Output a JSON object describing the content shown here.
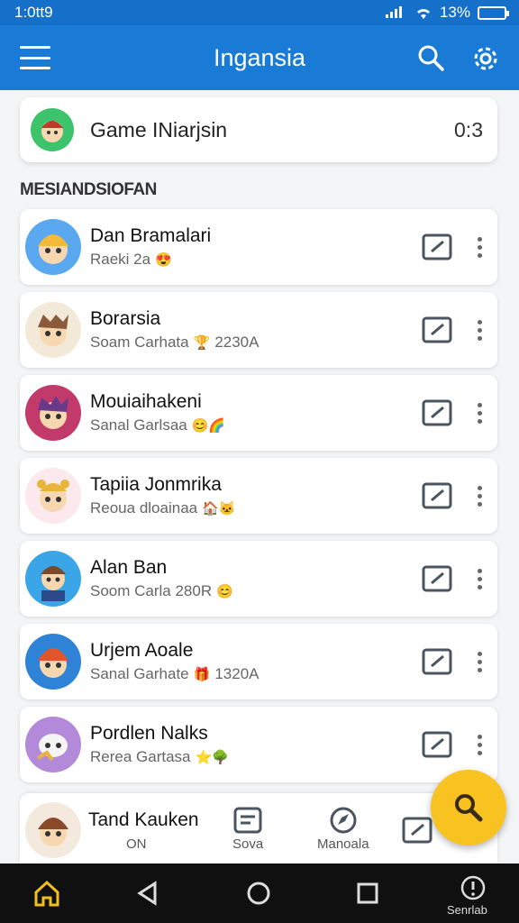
{
  "status_bar": {
    "time": "1:0tt9",
    "battery": "13%"
  },
  "app_bar": {
    "title": "Ingansia",
    "icons": [
      "menu-icon",
      "search-icon",
      "gear-icon"
    ]
  },
  "game_card": {
    "title": "Game INiarjsin",
    "score": "0:3"
  },
  "section_title": "MESIANDSIOFAN",
  "contacts": [
    {
      "name": "Dan Bramalari",
      "status": "Raeki 2a",
      "emoji": "😍",
      "extra": "",
      "avatar_bg": "#5aa8ef"
    },
    {
      "name": "Borarsia",
      "status": "Soam Carhata",
      "emoji": "🏆",
      "extra": "2230A",
      "avatar_bg": "#f2e9d8"
    },
    {
      "name": "Mouiaihakeni",
      "status": "Sanal Garlsaa",
      "emoji": "😊🌈",
      "extra": "",
      "avatar_bg": "#c23a6a"
    },
    {
      "name": "Tapiia Jonmrika",
      "status": "Reoua dloainaa",
      "emoji": "🏠🐱",
      "extra": "",
      "avatar_bg": "#fbe9ee"
    },
    {
      "name": "Alan Ban",
      "status": "Soom Carla 280R",
      "emoji": "😊",
      "extra": "",
      "avatar_bg": "#3aa6e8"
    },
    {
      "name": "Urjem Aoale",
      "status": "Sanal Garhate",
      "emoji": "🎁",
      "extra": "1320A",
      "avatar_bg": "#2f83d6"
    },
    {
      "name": "Pordlen Nalks",
      "status": "Rerea Gartasa",
      "emoji": "⭐🌳",
      "extra": "",
      "avatar_bg": "#b38ad9"
    }
  ],
  "bottom_bar": {
    "title": "Tand Kauken",
    "items": [
      {
        "label": "ON"
      },
      {
        "label": "Sova"
      },
      {
        "label": "Manoala"
      }
    ]
  },
  "system_nav": {
    "label": "Senrlab"
  }
}
